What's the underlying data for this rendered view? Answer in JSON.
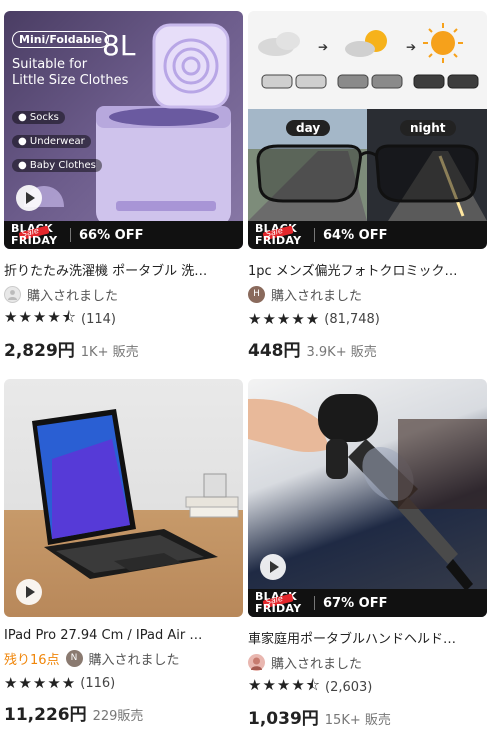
{
  "products": [
    {
      "title": "折りたたみ洗濯機 ポータブル 洗…",
      "avatar_initial": "",
      "remaining": "",
      "purchased": "購入されました",
      "stars": "★★★★⯪",
      "rating_count": "(114)",
      "price": "2,829円",
      "sold": "1K+ 販売",
      "discount": "66% OFF",
      "image": {
        "badge_top": "Mini/Foldable",
        "capacity": "8L",
        "headline_1": "Suitable for",
        "headline_2": "Little Size Clothes",
        "tags": [
          "Socks",
          "Underwear",
          "Baby Clothes"
        ]
      }
    },
    {
      "title": "1pc メンズ偏光フォトクロミックサ…",
      "avatar_initial": "H",
      "remaining": "",
      "purchased": "購入されました",
      "stars": "★★★★★",
      "rating_count": "(81,748)",
      "price": "448円",
      "sold": "3.9K+ 販売",
      "discount": "64% OFF",
      "image": {
        "label_day": "day",
        "label_night": "night"
      }
    },
    {
      "title": "IPad Pro 27.94 Cm / IPad Air …",
      "avatar_initial": "N",
      "remaining": "残り16点",
      "purchased": "購入されました",
      "stars": "★★★★★",
      "rating_count": "(116)",
      "price": "11,226円",
      "sold": "229販売",
      "discount": "",
      "image": {}
    },
    {
      "title": "車家庭用ポータブルハンドヘルドデ…",
      "avatar_initial": "",
      "remaining": "",
      "purchased": "購入されました",
      "stars": "★★★★⯪",
      "rating_count": "(2,603)",
      "price": "1,039円",
      "sold": "15K+ 販売",
      "discount": "67% OFF",
      "image": {}
    }
  ],
  "promo": {
    "line1": "BLACK",
    "line2": "FRIDAY",
    "script": "Sale"
  },
  "colors": {
    "remaining": "#f0860a",
    "promo_red": "#e3262b",
    "badge_bg": "#111111"
  }
}
